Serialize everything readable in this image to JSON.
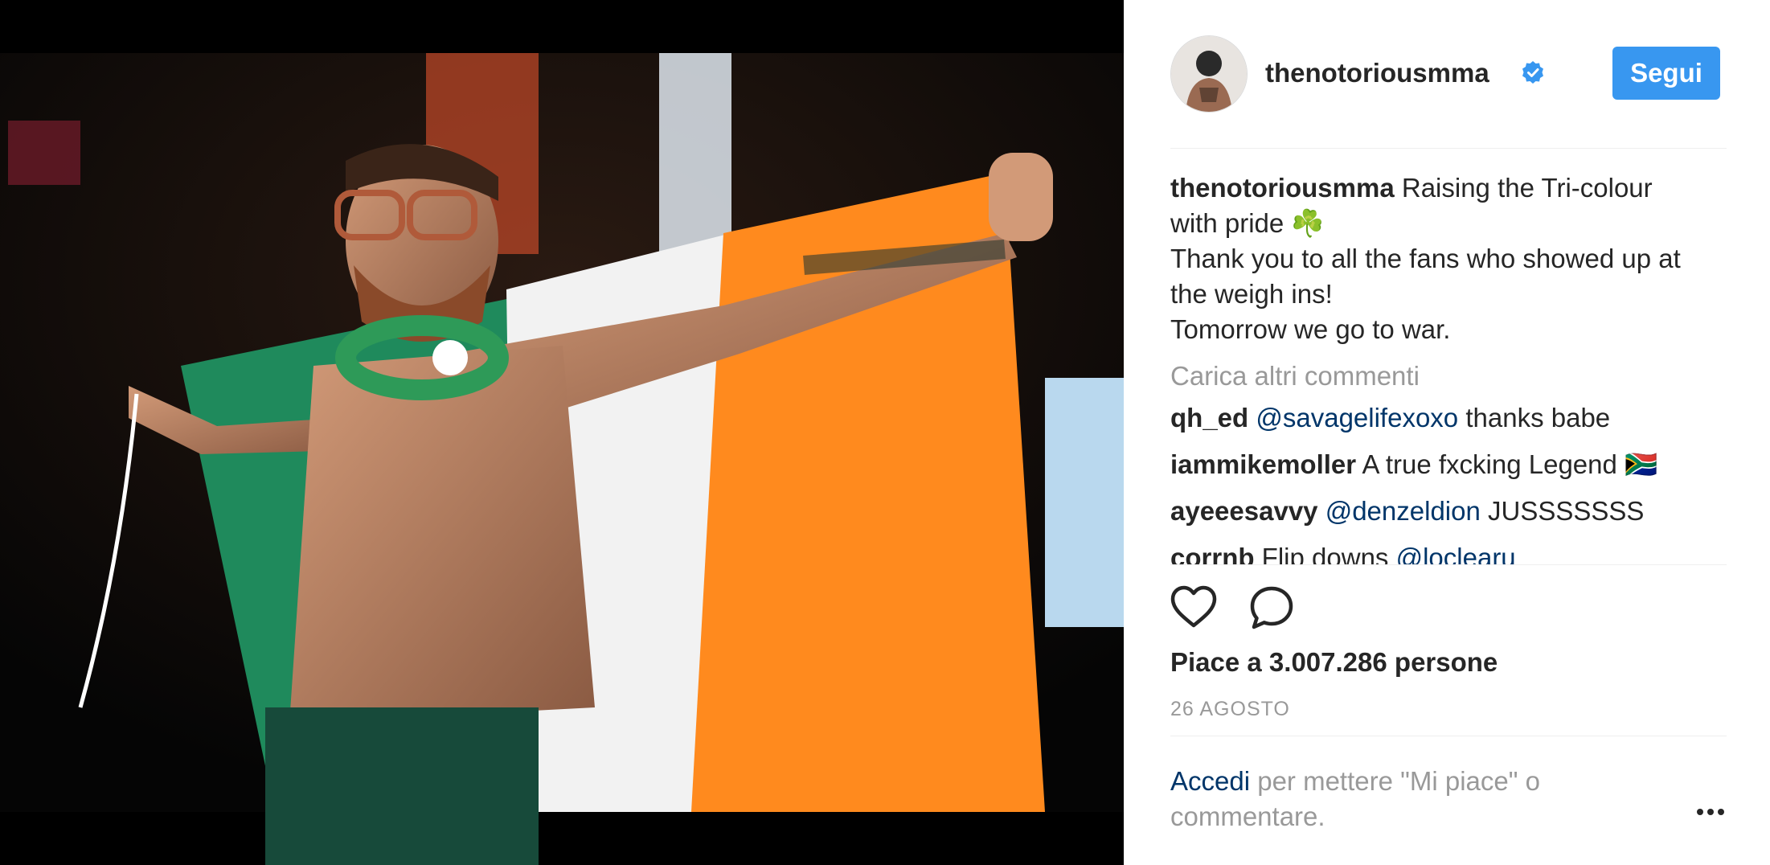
{
  "post": {
    "username": "thenotoriousmma",
    "follow_label": "Segui",
    "caption_user": "thenotoriousmma",
    "caption_lines": [
      "Raising the Tri-colour",
      "with pride ☘️",
      "Thank you to all the fans who showed up at",
      "the weigh ins!",
      "Tomorrow we go to war."
    ],
    "load_more": "Carica altri commenti",
    "comments": [
      {
        "user": "qh_ed",
        "mention": "@savagelifexoxo",
        "text": " thanks babe"
      },
      {
        "user": "iammikemoller",
        "mention": "",
        "text": " A true fxcking Legend 🇿🇦"
      },
      {
        "user": "ayeeesavvy",
        "mention": "@denzeldion",
        "text": " JUSSSSSSS"
      },
      {
        "user": "corrnb",
        "mention": "@loclearu",
        "text": " Flip downs "
      }
    ],
    "likes": "Piace a 3.007.286 persone",
    "date": "26 AGOSTO",
    "login_link": "Accedi",
    "login_text": " per mettere \"Mi piace\" o commentare."
  },
  "icons": {
    "verified": "verified-badge-icon",
    "like": "heart-icon",
    "comment": "comment-bubble-icon",
    "more": "more-options-icon"
  },
  "colors": {
    "accent": "#3897f0",
    "link": "#003569",
    "muted": "#999999",
    "flag_green": "#1f8a5c",
    "flag_white": "#f2f2f2",
    "flag_orange": "#ff8a1e"
  }
}
